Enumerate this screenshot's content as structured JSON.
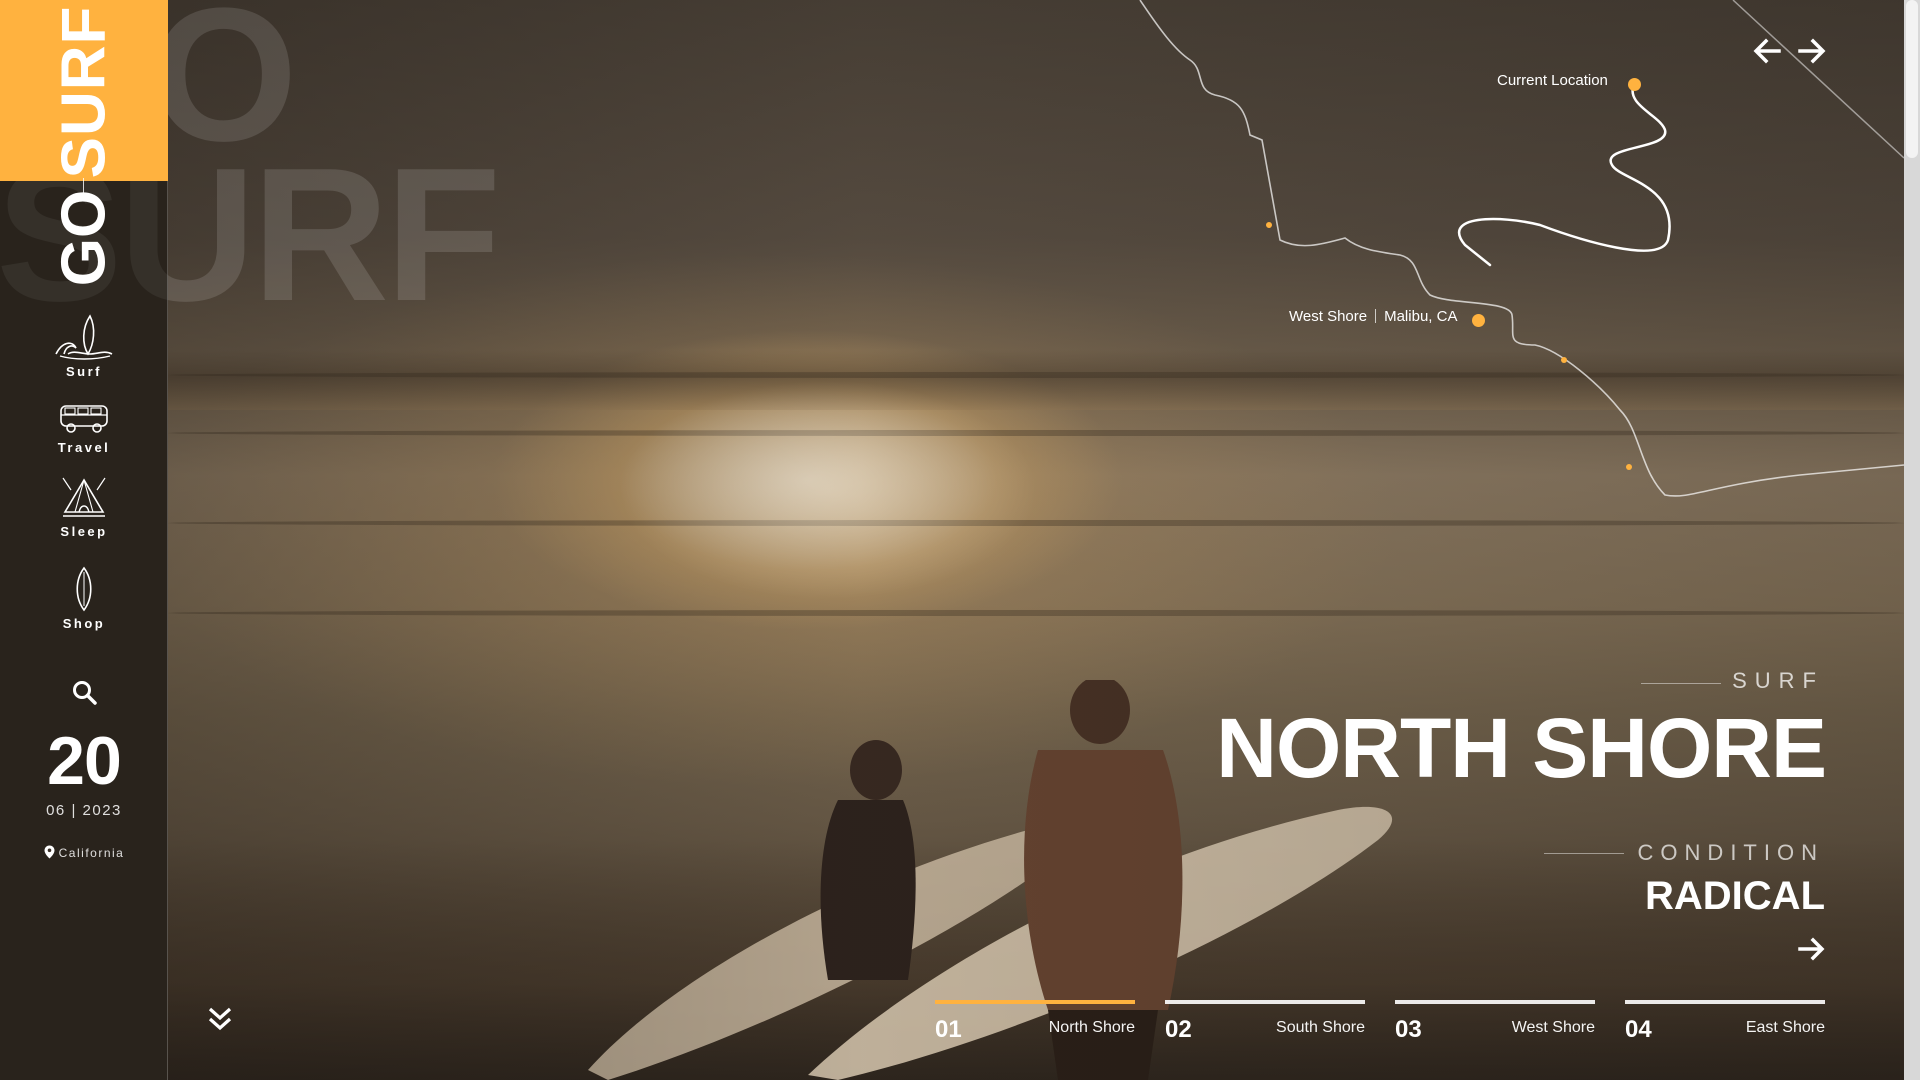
{
  "brand": {
    "top": "SURF",
    "bottom": "GO"
  },
  "background_text": {
    "word": "SURF",
    "partial": "O"
  },
  "nav": [
    {
      "label": "Surf",
      "icon": "surf-wave-icon"
    },
    {
      "label": "Travel",
      "icon": "van-icon"
    },
    {
      "label": "Sleep",
      "icon": "tent-icon"
    },
    {
      "label": "Shop",
      "icon": "surfboard-icon"
    }
  ],
  "date": {
    "day": "20",
    "month_year": "06 | 2023"
  },
  "location": {
    "name": "California",
    "icon": "map-pin-icon"
  },
  "map": {
    "current_location": "Current Location",
    "spot_name": "West Shore",
    "spot_place": "Malibu, CA"
  },
  "hero": {
    "kicker": "SURF",
    "title": "NORTH SHORE",
    "condition_label": "CONDITION",
    "condition_value": "RADICAL"
  },
  "tabs": [
    {
      "num": "01",
      "name": "North Shore",
      "active": true
    },
    {
      "num": "02",
      "name": "South Shore",
      "active": false
    },
    {
      "num": "03",
      "name": "West Shore",
      "active": false
    },
    {
      "num": "04",
      "name": "East Shore",
      "active": false
    }
  ],
  "colors": {
    "accent": "#FFB23F",
    "text": "#FFFFFF"
  }
}
